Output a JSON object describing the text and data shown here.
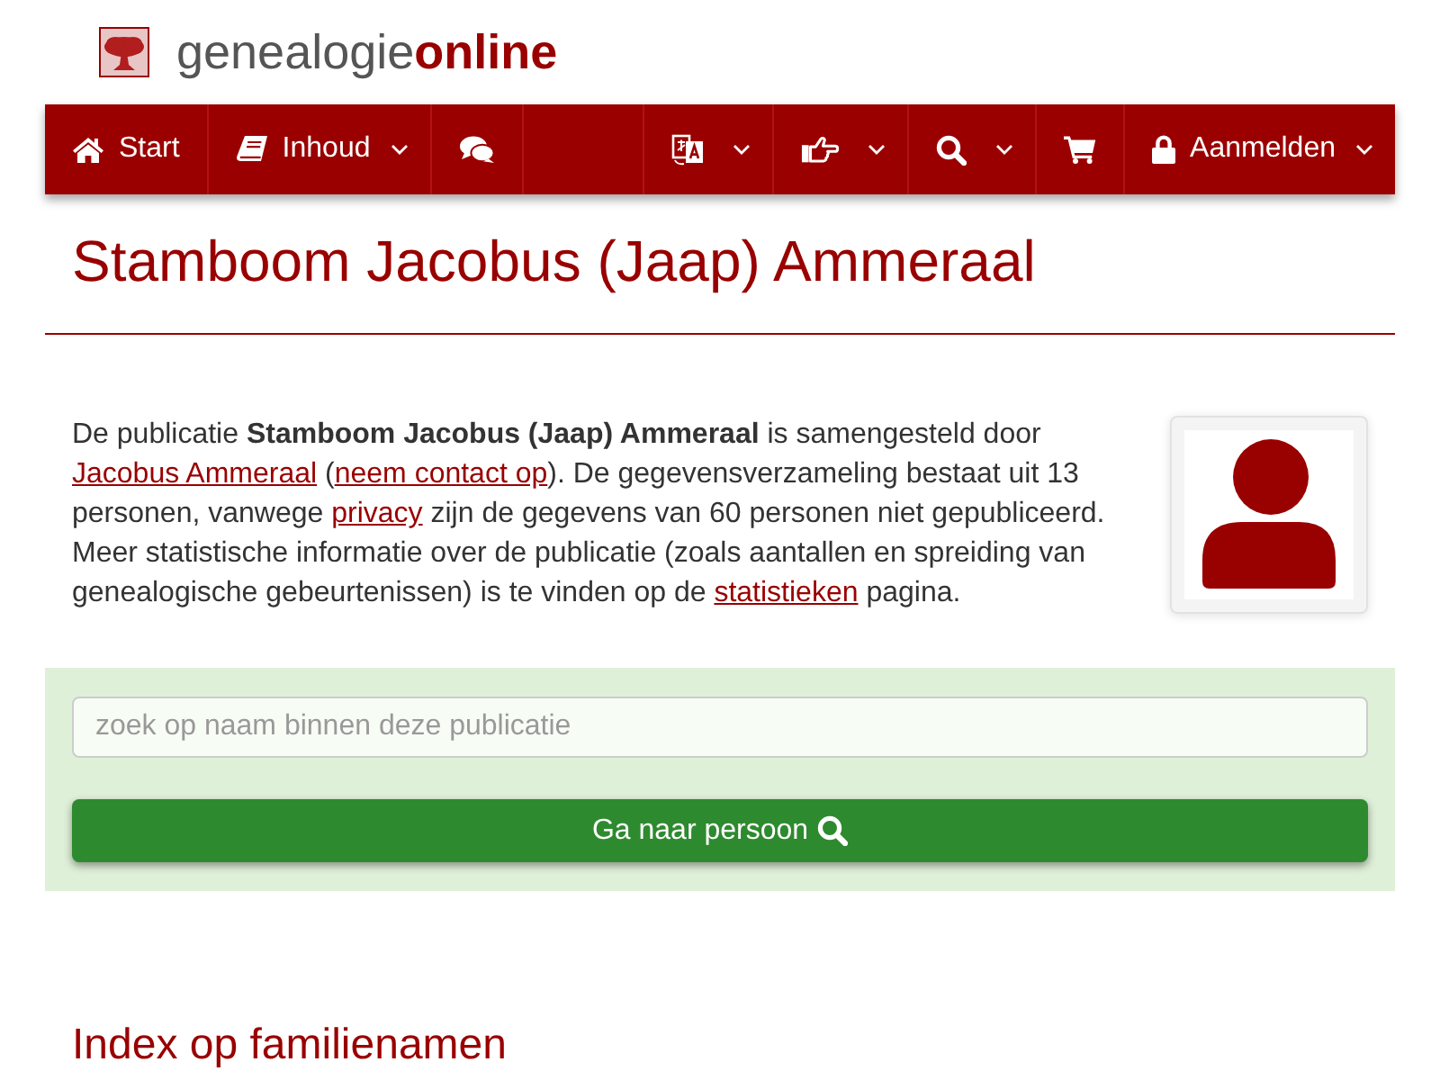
{
  "header": {
    "logo": {
      "name_first": "genealogie",
      "name_second": "online"
    }
  },
  "nav": {
    "left": [
      {
        "label": "Start",
        "has_menu": false
      },
      {
        "label": "Inhoud",
        "has_menu": true
      },
      {
        "has_menu": false
      }
    ],
    "right": [
      {
        "has_menu": true
      },
      {
        "has_menu": true
      },
      {
        "has_menu": true
      },
      {
        "has_menu": false
      },
      {
        "label": "Aanmelden",
        "has_menu": true
      }
    ]
  },
  "page_title": "Stamboom Jacobus (Jaap) Ammeraal",
  "intro": {
    "parts": [
      {
        "kind": "text",
        "text": "De publicatie **Stamboom Jacobus (Jaap) Ammeraal** is samengesteld door "
      },
      {
        "kind": "link",
        "text": "Jacobus Ammeraal"
      },
      {
        "kind": "text",
        "text": " ("
      },
      {
        "kind": "link",
        "text": "neem contact op"
      },
      {
        "kind": "text",
        "text": "). De gegevensverzameling bestaat uit 13 personen, vanwege "
      },
      {
        "kind": "link",
        "text": "privacy"
      },
      {
        "kind": "text",
        "text": " zijn de gegevens van 60 personen niet gepubliceerd. Meer statistische informatie over de publicatie (zoals aantallen en spreiding van genealogische gebeurtenissen) is te vinden op de "
      },
      {
        "kind": "link",
        "text": "statistieken"
      },
      {
        "kind": "text",
        "text": " pagina."
      }
    ]
  },
  "search": {
    "placeholder": "zoek op naam binnen deze publicatie",
    "button": "Ga naar persoon"
  },
  "section_heading": "Index op familienamen"
}
